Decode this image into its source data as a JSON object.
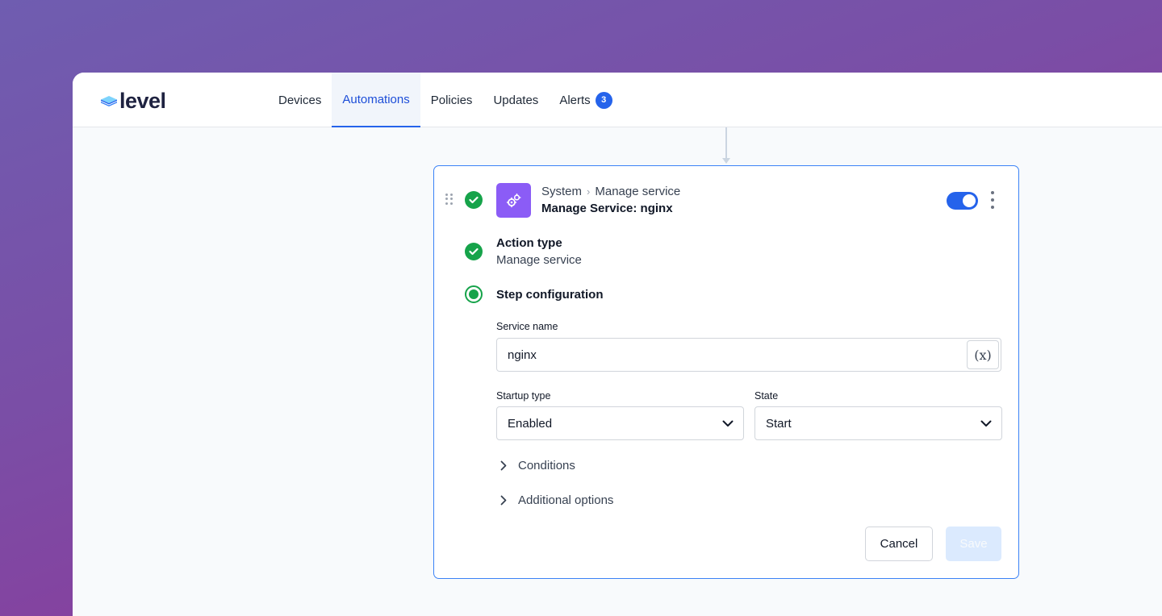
{
  "brand": {
    "name": "level",
    "accent": "#2563eb"
  },
  "nav": {
    "items": [
      {
        "label": "Devices",
        "active": false
      },
      {
        "label": "Automations",
        "active": true
      },
      {
        "label": "Policies",
        "active": false
      },
      {
        "label": "Updates",
        "active": false
      },
      {
        "label": "Alerts",
        "active": false,
        "badge": "3"
      }
    ]
  },
  "step": {
    "breadcrumb": {
      "parent": "System",
      "current": "Manage service"
    },
    "title": "Manage Service: nginx",
    "enabled": true,
    "icon": "gears-icon"
  },
  "action": {
    "label": "Action type",
    "value": "Manage service"
  },
  "config": {
    "label": "Step configuration",
    "service_name": {
      "label": "Service name",
      "value": "nginx",
      "variable_button": "(x)"
    },
    "startup_type": {
      "label": "Startup type",
      "value": "Enabled"
    },
    "state": {
      "label": "State",
      "value": "Start"
    }
  },
  "sections": {
    "conditions": "Conditions",
    "additional": "Additional options"
  },
  "buttons": {
    "cancel": "Cancel",
    "save": "Save"
  },
  "colors": {
    "success": "#16a34a",
    "step_icon": "#8b5cf6",
    "card_border": "#3b82f6"
  }
}
